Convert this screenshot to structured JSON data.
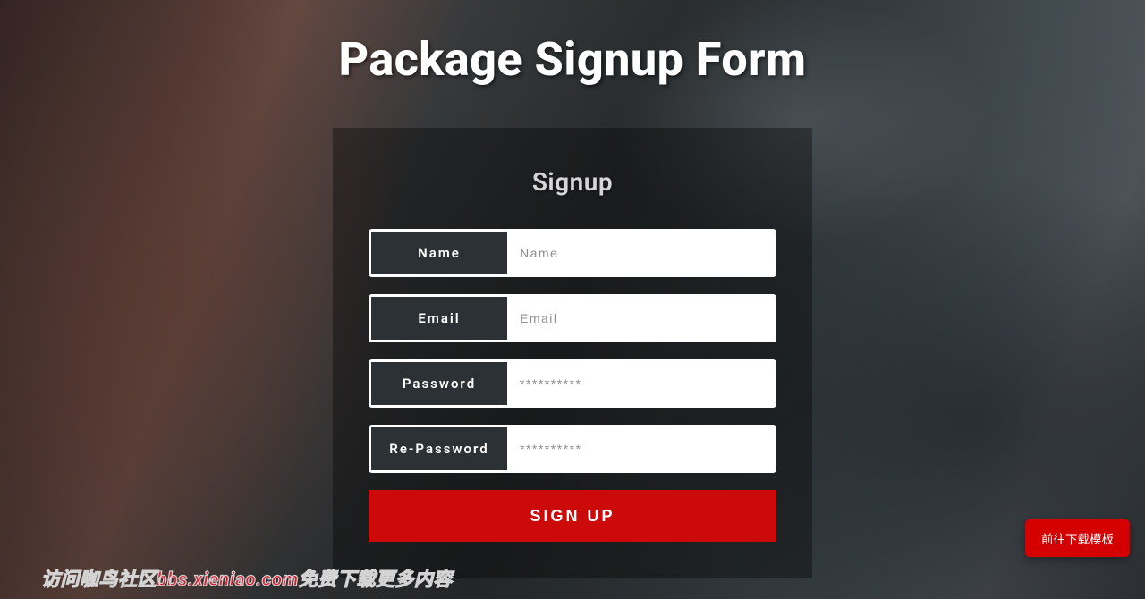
{
  "page": {
    "title": "Package Signup Form"
  },
  "form": {
    "heading": "Signup",
    "fields": {
      "name": {
        "label": "Name",
        "placeholder": "Name",
        "type": "text"
      },
      "email": {
        "label": "Email",
        "placeholder": "Email",
        "type": "email"
      },
      "password": {
        "label": "Password",
        "placeholder": "**********",
        "type": "password"
      },
      "repassword": {
        "label": "Re-Password",
        "placeholder": "**********",
        "type": "password"
      }
    },
    "submit_label": "SIGN UP"
  },
  "float_button": {
    "label": "前往下载模板"
  },
  "promo": {
    "text": "访问咖鸟社区bbs.xieniao.com免费下载更多内容"
  },
  "colors": {
    "accent": "#cc0a0a",
    "label_bg": "#2b3134"
  }
}
